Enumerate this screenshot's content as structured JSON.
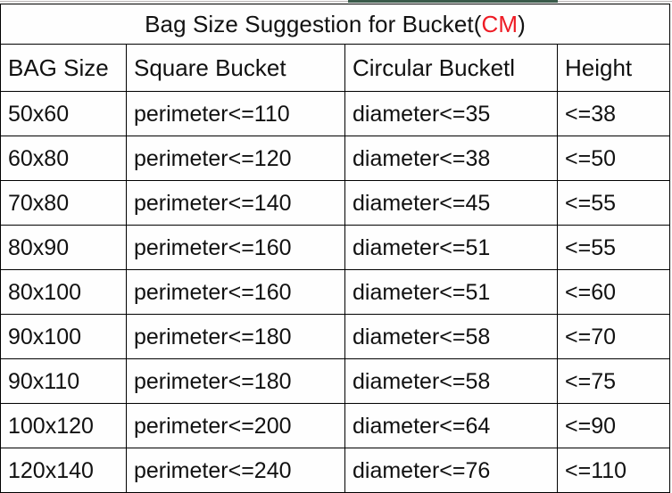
{
  "accent": {
    "green_bar_color": "#3a5a4a",
    "highlight_color": "#ee1c25",
    "text_color": "#121212",
    "border_color": "#000000",
    "background_color": "#fefefe"
  },
  "table": {
    "title": {
      "main": "Bag Size Suggestion for Bucket",
      "open_paren": "(",
      "unit": "CM",
      "close_paren": ")",
      "full": "Bag Size Suggestion for Bucket(CM)"
    },
    "columns": [
      {
        "key": "bag_size",
        "label": "BAG Size"
      },
      {
        "key": "square_bucket",
        "label": "Square Bucket"
      },
      {
        "key": "circular_bucket",
        "label": "Circular Bucketl"
      },
      {
        "key": "height",
        "label": "Height"
      }
    ],
    "rows": [
      {
        "bag_size": "50x60",
        "square_bucket": "perimeter<=110",
        "circular_bucket": "diameter<=35",
        "height": "<=38"
      },
      {
        "bag_size": "60x80",
        "square_bucket": "perimeter<=120",
        "circular_bucket": "diameter<=38",
        "height": "<=50"
      },
      {
        "bag_size": "70x80",
        "square_bucket": "perimeter<=140",
        "circular_bucket": "diameter<=45",
        "height": "<=55"
      },
      {
        "bag_size": "80x90",
        "square_bucket": "perimeter<=160",
        "circular_bucket": "diameter<=51",
        "height": "<=55"
      },
      {
        "bag_size": "80x100",
        "square_bucket": "perimeter<=160",
        "circular_bucket": "diameter<=51",
        "height": "<=60"
      },
      {
        "bag_size": "90x100",
        "square_bucket": "perimeter<=180",
        "circular_bucket": "diameter<=58",
        "height": "<=70"
      },
      {
        "bag_size": "90x110",
        "square_bucket": "perimeter<=180",
        "circular_bucket": "diameter<=58",
        "height": "<=75"
      },
      {
        "bag_size": "100x120",
        "square_bucket": "perimeter<=200",
        "circular_bucket": "diameter<=64",
        "height": "<=90"
      },
      {
        "bag_size": "120x140",
        "square_bucket": "perimeter<=240",
        "circular_bucket": "diameter<=76",
        "height": "<=110"
      }
    ]
  }
}
